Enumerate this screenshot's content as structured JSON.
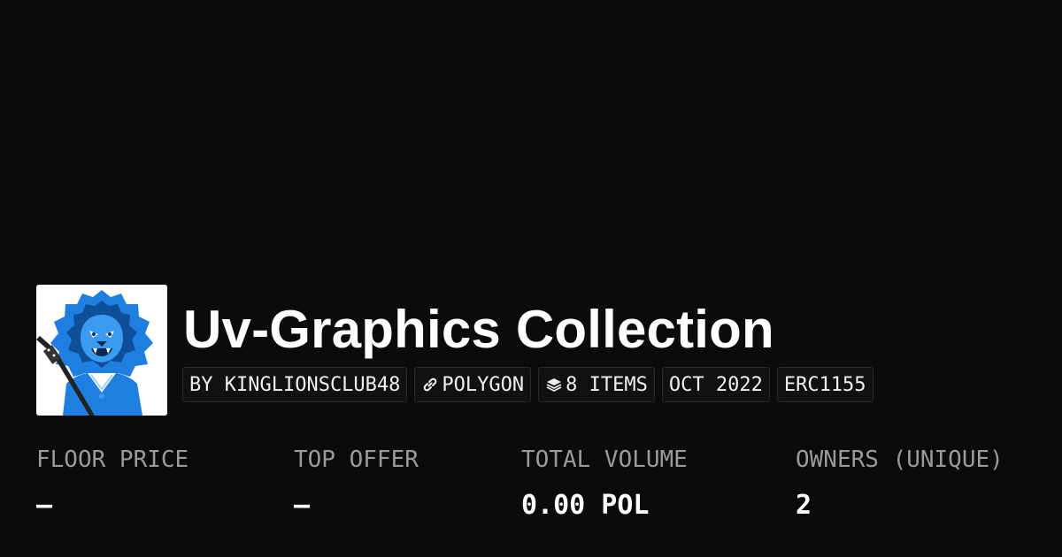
{
  "collection": {
    "title": "Uv-Graphics Collection",
    "avatar_alt": "lion-avatar"
  },
  "badges": [
    {
      "label": "BY KINGLIONSCLUB48",
      "icon": null
    },
    {
      "label": "POLYGON",
      "icon": "link-icon"
    },
    {
      "label": "8 ITEMS",
      "icon": "layers-icon"
    },
    {
      "label": "OCT 2022",
      "icon": null
    },
    {
      "label": "ERC1155",
      "icon": null
    }
  ],
  "stats": [
    {
      "label": "FLOOR PRICE",
      "value": "–"
    },
    {
      "label": "TOP OFFER",
      "value": "–"
    },
    {
      "label": "TOTAL VOLUME",
      "value": "0.00 POL"
    },
    {
      "label": "OWNERS (UNIQUE)",
      "value": "2"
    }
  ],
  "colors": {
    "background": "#0b0b0b",
    "text": "#ffffff",
    "muted": "#9a9a9a",
    "badge_border": "#2a2a2a",
    "lion_blue": "#1f7fe0"
  }
}
